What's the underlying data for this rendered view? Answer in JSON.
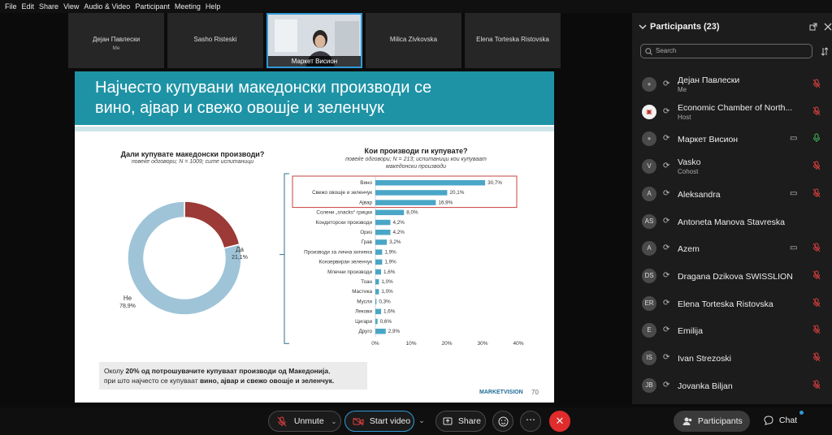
{
  "menu": [
    "File",
    "Edit",
    "Share",
    "View",
    "Audio & Video",
    "Participant",
    "Meeting",
    "Help"
  ],
  "thumbnails": [
    {
      "name": "Дејан Павлески",
      "sub": "Me"
    },
    {
      "name": "Sasho Risteski",
      "sub": ""
    },
    {
      "name": "Milica Zivkovska",
      "sub": ""
    },
    {
      "name": "Elena Torteska Ristovska",
      "sub": ""
    }
  ],
  "active_speaker": "Маркет Висион",
  "slide": {
    "title_line1": "Најчесто купувани македонски производи се",
    "title_line2": "вино, ајвар и свежо овошје и зеленчук",
    "q1_title": "Дали купувате македонски производи?",
    "q1_sub": "повеќе одговори; N = 1009; сите испитаници",
    "q2_title": "Кои производи ги купувате?",
    "q2_sub_line1": "повеќе одговори; N = 213; испитаници кои купуваат",
    "q2_sub_line2": "македонски производи",
    "note_line1_a": "Околу ",
    "note_line1_b": "20% од потрошувачите купуваат производи од Македонија",
    "note_line1_c": ",",
    "note_line2_a": "при што најчесто се купуваат ",
    "note_line2_b": "вино, ајвар и свежо овошје и зеленчук.",
    "brand": "MARKETVISION",
    "page": "70"
  },
  "chart_data": [
    {
      "type": "pie",
      "title": "Дали купувате македонски производи?",
      "labels": [
        "Да",
        "Не"
      ],
      "values": [
        21.1,
        78.9
      ],
      "value_labels": [
        "21,1%",
        "78,9%"
      ],
      "colors": [
        "#9b3a36",
        "#9fc4d8"
      ]
    },
    {
      "type": "bar",
      "orientation": "horizontal",
      "title": "Кои производи ги купувате?",
      "categories": [
        "Вино",
        "Свежо овошје и зеленчук",
        "Ајвар",
        "Солени „snacks“ грицки",
        "Кондиторски производи",
        "Ориз",
        "Грав",
        "Производи за лична хигиена",
        "Конзервиран зеленчук",
        "Млечни производи",
        "Тоан",
        "Мастика",
        "Мусли",
        "Лекови",
        "Цигари",
        "Друго"
      ],
      "values": [
        30.7,
        20.1,
        16.9,
        8.0,
        4.2,
        4.2,
        3.2,
        1.9,
        1.9,
        1.6,
        1.0,
        1.0,
        0.3,
        1.6,
        0.6,
        2.9
      ],
      "value_labels": [
        "30,7%",
        "20,1%",
        "16,9%",
        "8,0%",
        "4,2%",
        "4,2%",
        "3,2%",
        "1,9%",
        "1,9%",
        "1,6%",
        "1,0%",
        "1,0%",
        "0,3%",
        "1,6%",
        "0,6%",
        "2,9%"
      ],
      "x_ticks": [
        "0%",
        "10%",
        "20%",
        "30%",
        "40%"
      ],
      "xlim": [
        0,
        40
      ],
      "highlighted": [
        "Вино",
        "Свежо овошје и зеленчук",
        "Ајвар"
      ],
      "color": "#4aa6c6"
    }
  ],
  "participants": {
    "header": "Participants (23)",
    "search_placeholder": "Search",
    "list": [
      {
        "name": "Дејан Павлески",
        "sub": "Me",
        "avatar": "",
        "video": false,
        "mic": "muted"
      },
      {
        "name": "Economic Chamber of North...",
        "sub": "Host",
        "avatar": "logo",
        "video": false,
        "mic": "muted"
      },
      {
        "name": "Маркет Висион",
        "sub": "",
        "avatar": "",
        "video": true,
        "mic": "on"
      },
      {
        "name": "Vasko",
        "sub": "Cohost",
        "avatar": "V",
        "video": false,
        "mic": "muted"
      },
      {
        "name": "Aleksandra",
        "sub": "",
        "avatar": "A",
        "video": true,
        "mic": "muted"
      },
      {
        "name": "Antoneta Manova Stavreska",
        "sub": "",
        "avatar": "AS",
        "video": false,
        "mic": ""
      },
      {
        "name": "Azem",
        "sub": "",
        "avatar": "A",
        "video": true,
        "mic": "muted"
      },
      {
        "name": "Dragana Dzikova SWISSLION",
        "sub": "",
        "avatar": "DS",
        "video": false,
        "mic": "muted"
      },
      {
        "name": "Elena Torteska Ristovska",
        "sub": "",
        "avatar": "ER",
        "video": false,
        "mic": "muted"
      },
      {
        "name": "Emilija",
        "sub": "",
        "avatar": "E",
        "video": false,
        "mic": "muted"
      },
      {
        "name": "Ivan Strezoski",
        "sub": "",
        "avatar": "IS",
        "video": false,
        "mic": "muted"
      },
      {
        "name": "Jovanka Biljan",
        "sub": "",
        "avatar": "JB",
        "video": false,
        "mic": "muted"
      }
    ]
  },
  "controls": {
    "unmute": "Unmute",
    "start_video": "Start video",
    "share": "Share",
    "participants": "Participants",
    "chat": "Chat"
  },
  "colors": {
    "accent": "#2f9bd9",
    "slide_header": "#1f93a6",
    "end_button": "#e02c2c",
    "muted_red": "#e04040"
  }
}
